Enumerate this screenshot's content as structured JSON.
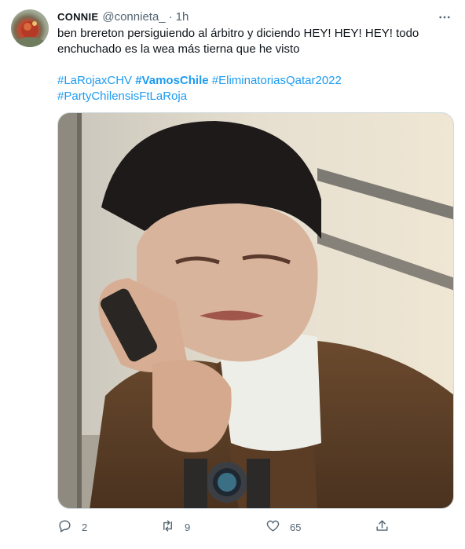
{
  "tweet": {
    "display_name": "CONNIE",
    "handle": "@connieta_",
    "separator": "·",
    "time": "1h",
    "text_line1": "ben brereton persiguiendo al árbitro y diciendo HEY! HEY! HEY! todo",
    "text_line2": "enchuchado es la wea más tierna que he visto",
    "hashtags": [
      "#LaRojaxCHV",
      "#VamosChile",
      "#EliminatoriasQatar2022",
      "#PartyChilensisFtLaRoja"
    ]
  },
  "actions": {
    "reply_count": "2",
    "retweet_count": "9",
    "like_count": "65"
  },
  "colors": {
    "link": "#1d9bf0",
    "muted": "#536471",
    "text": "#0f1419"
  }
}
